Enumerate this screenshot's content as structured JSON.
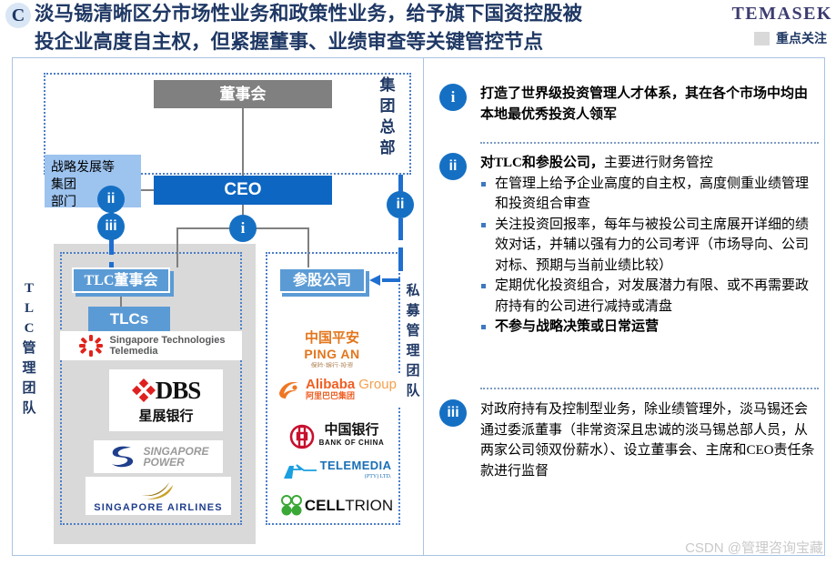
{
  "header": {
    "badge": "C",
    "title_line1": "淡马锡清晰区分市场性业务和政策性业务，给予旗下国资控股被",
    "title_line2": "投企业高度自主权，但紧握董事、业绩审查等关键管控节点",
    "brand": "TEMASEK",
    "focus_legend_label": "重点关注",
    "colors": {
      "title": "#1f3864",
      "brand": "#3c3c70",
      "accent_blue": "#1570c4",
      "box_blue": "#0d66c2",
      "light_blue": "#5b9bd5",
      "pale_blue": "#9dc3ef",
      "grey_box": "#808080",
      "panel_grey": "#d9d9d9",
      "swatch": "#d9d9d9"
    }
  },
  "diagram": {
    "board_label": "董事会",
    "ceo_label": "CEO",
    "dept_label": "战略发展等集团\n部门",
    "dept_lines": [
      "战略发展等",
      "集团",
      "部门"
    ],
    "hq_vertical_label": [
      "集",
      "团",
      "总",
      "部"
    ],
    "tlc_vertical_label": [
      "T",
      "L",
      "C",
      "管",
      "理",
      "团",
      "队"
    ],
    "pe_vertical_label": [
      "私",
      "募",
      "管",
      "理",
      "团",
      "队"
    ],
    "tlc_board_label": "TLC董事会",
    "tlcs_label": "TLCs",
    "associate_label": "参股公司",
    "markers": {
      "i": "i",
      "ii": "ii",
      "iii": "iii"
    },
    "tlc_logos": [
      {
        "name": "singapore-technologies-telemedia",
        "line1": "Singapore Technologies",
        "line2": "Telemedia"
      },
      {
        "name": "dbs-bank",
        "line1": "DBS",
        "line2": "星展银行"
      },
      {
        "name": "singapore-power",
        "line1": "SINGAPORE",
        "line2": "POWER"
      },
      {
        "name": "singapore-airlines",
        "line1": "SINGAPORE AIRLINES",
        "line2": ""
      }
    ],
    "associate_logos": [
      {
        "name": "ping-an",
        "line1": "中国平安",
        "line2": "PING AN",
        "line3": "保险·银行·投资"
      },
      {
        "name": "alibaba-group",
        "line1": "Alibaba",
        "line2": "Group",
        "line3": "阿里巴巴集团"
      },
      {
        "name": "bank-of-china",
        "line1": "中国银行",
        "line2": "BANK OF CHINA",
        "line3": ""
      },
      {
        "name": "telemedia",
        "line1": "TELEMEDIA",
        "line2": "(PTY) LTD.",
        "line3": ""
      },
      {
        "name": "celltrion",
        "line1": "CELL",
        "line2": "TRION",
        "line3": ""
      }
    ]
  },
  "right_panel": {
    "items": [
      {
        "marker": "i",
        "lead": "打造了世界级投资管理人才体系，其在各个市场中均由本地最优秀投资人领军",
        "bullets": []
      },
      {
        "marker": "ii",
        "lead_bold": "对TLC和参股公司，",
        "lead_rest": "主要进行财务管控",
        "bullets": [
          "在管理上给予企业高度的自主权，高度侧重业绩管理和投资组合审查",
          "关注投资回报率，每年与被投公司主席展开详细的绩效对话，并辅以强有力的公司考评（市场导向、公司对标、预期与当前业绩比较）",
          "定期优化投资组合，对发展潜力有限、或不再需要政府持有的公司进行减持或清盘",
          "不参与战略决策或日常运营"
        ]
      },
      {
        "marker": "iii",
        "lead": "对政府持有及控制型业务，除业绩管理外，淡马锡还会通过委派董事（非常资深且忠诚的淡马锡总部人员，从两家公司领双份薪水）、设立董事会、主席和CEO责任条款进行监督",
        "bullets": []
      }
    ]
  },
  "watermark": "CSDN @管理咨询宝藏"
}
